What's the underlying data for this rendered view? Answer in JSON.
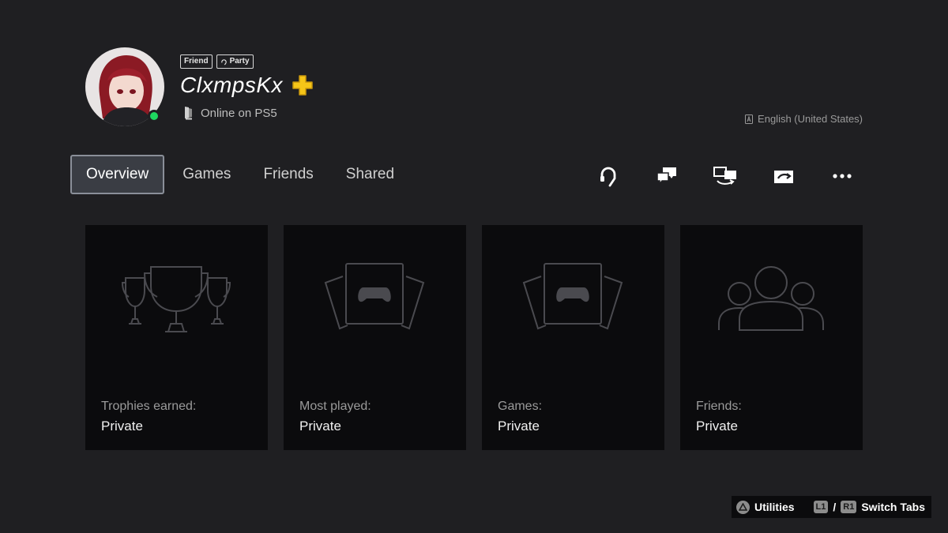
{
  "profile": {
    "username": "ClxmpsKx",
    "status": "Online on PS5",
    "badges": {
      "friend": "Friend",
      "party": "Party"
    },
    "language": "English (United States)",
    "online_color": "#1ed760",
    "plus_color": "#f5c518"
  },
  "tabs": [
    {
      "label": "Overview",
      "active": true
    },
    {
      "label": "Games",
      "active": false
    },
    {
      "label": "Friends",
      "active": false
    },
    {
      "label": "Shared",
      "active": false
    }
  ],
  "actions": [
    "headset-icon",
    "chat-icon",
    "share-screen-icon",
    "game-share-icon",
    "more-icon"
  ],
  "cards": [
    {
      "icon": "trophies-icon",
      "label": "Trophies earned:",
      "value": "Private"
    },
    {
      "icon": "games-icon",
      "label": "Most played:",
      "value": "Private"
    },
    {
      "icon": "games-icon",
      "label": "Games:",
      "value": "Private"
    },
    {
      "icon": "friends-icon",
      "label": "Friends:",
      "value": "Private"
    }
  ],
  "footer": {
    "utilities_label": "Utilities",
    "l1": "L1",
    "r1": "R1",
    "switch_tabs_label": "Switch Tabs"
  }
}
